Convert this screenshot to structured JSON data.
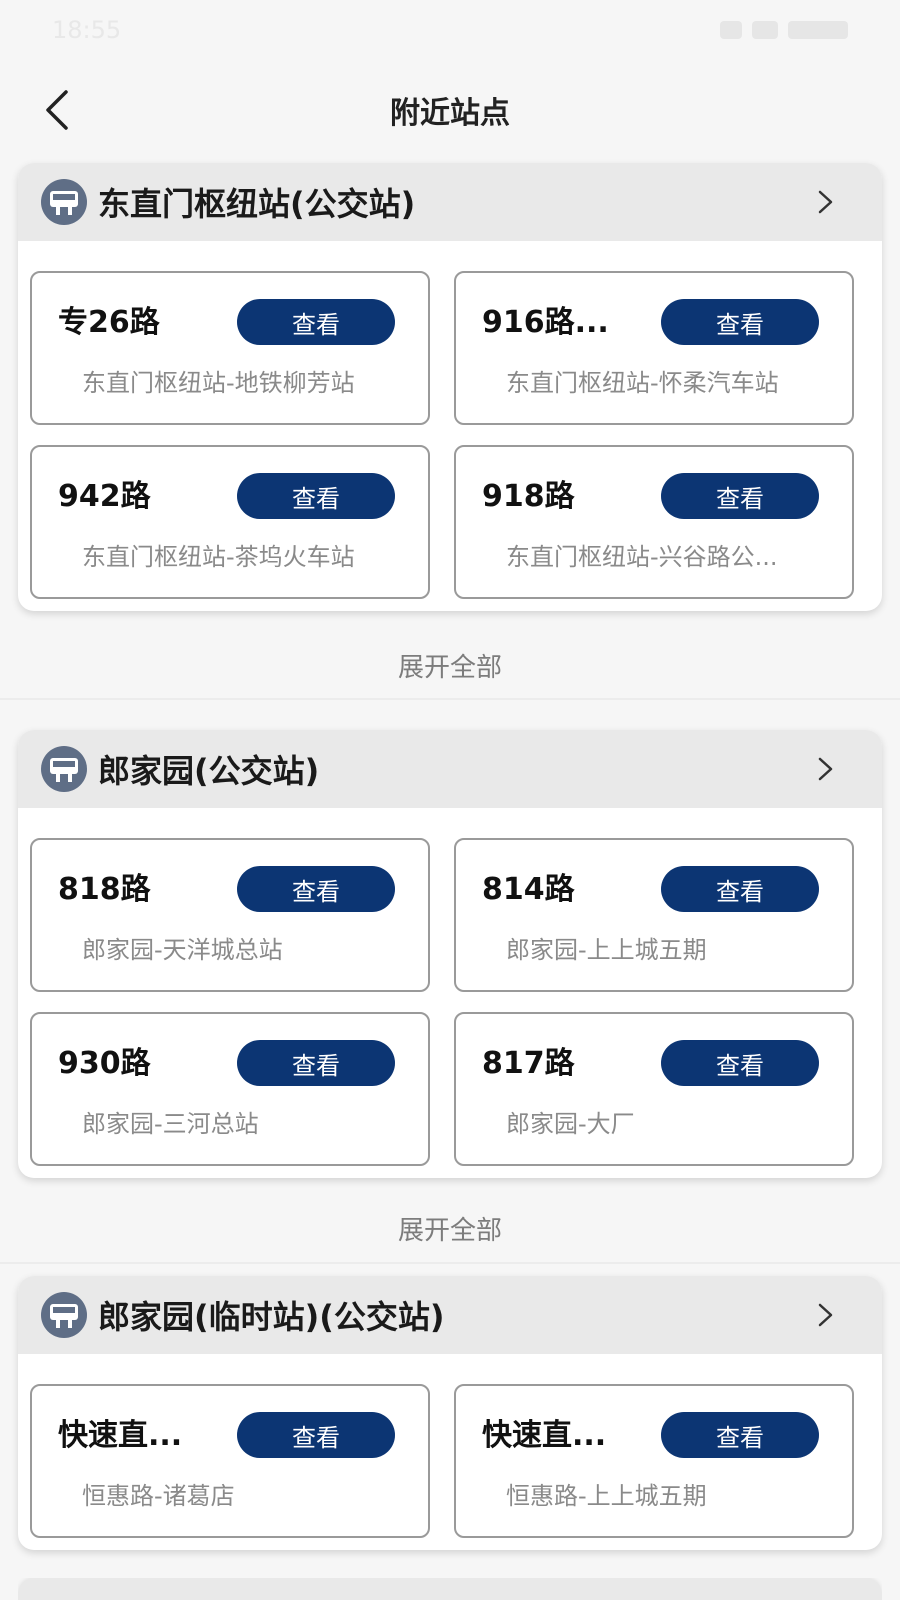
{
  "status_bar": {
    "time": "18:55"
  },
  "header": {
    "title": "附近站点"
  },
  "expand_label": "展开全部",
  "view_label": "查看",
  "stations": [
    {
      "name": "东直门枢纽站(公交站)",
      "routes": [
        {
          "name": "专26路",
          "destination": "东直门枢纽站-地铁柳芳站"
        },
        {
          "name": "916路...",
          "destination": "东直门枢纽站-怀柔汽车站"
        },
        {
          "name": "942路",
          "destination": "东直门枢纽站-茶坞火车站"
        },
        {
          "name": "918路",
          "destination": "东直门枢纽站-兴谷路公..."
        }
      ]
    },
    {
      "name": "郎家园(公交站)",
      "routes": [
        {
          "name": "818路",
          "destination": "郎家园-天洋城总站"
        },
        {
          "name": "814路",
          "destination": "郎家园-上上城五期"
        },
        {
          "name": "930路",
          "destination": "郎家园-三河总站"
        },
        {
          "name": "817路",
          "destination": "郎家园-大厂"
        }
      ]
    },
    {
      "name": "郎家园(临时站)(公交站)",
      "routes": [
        {
          "name": "快速直...",
          "destination": "恒惠路-诸葛店"
        },
        {
          "name": "快速直...",
          "destination": "恒惠路-上上城五期"
        }
      ]
    }
  ]
}
